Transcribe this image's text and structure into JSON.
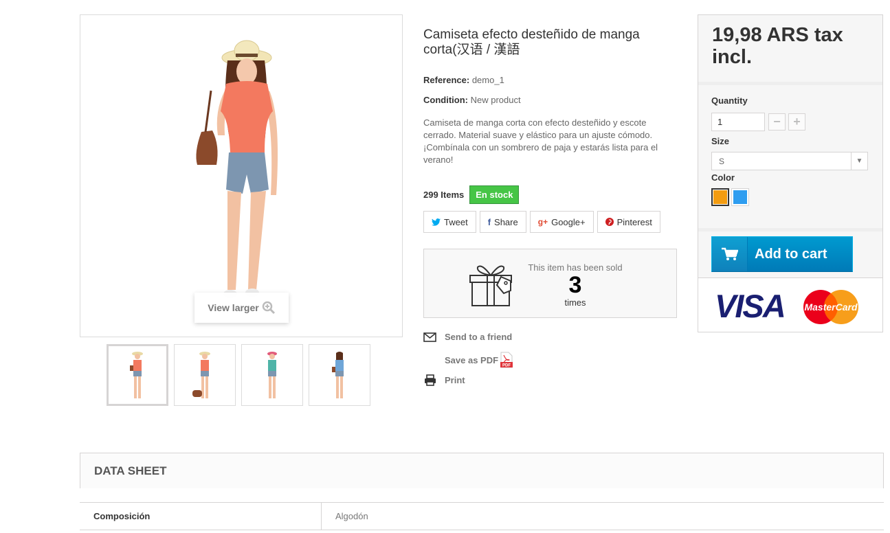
{
  "main_image": {
    "view_larger_label": "View larger",
    "thumbnail_count": 4
  },
  "product": {
    "title": "Camiseta efecto desteñido de manga corta(汉语 / 漢語",
    "reference_label": "Reference:",
    "reference_value": "demo_1",
    "condition_label": "Condition:",
    "condition_value": "New product",
    "description": "Camiseta de manga corta con efecto desteñido y escote cerrado. Material suave y elástico para un ajuste cómodo. ¡Combínala con un sombrero de paja y estarás lista para el verano!",
    "items_count": "299 Items",
    "stock_status": "En stock"
  },
  "social": [
    {
      "label": "Tweet",
      "icon": "twitter-icon",
      "color": "#00aaf0"
    },
    {
      "label": "Share",
      "icon": "facebook-icon",
      "color": "#435f9f"
    },
    {
      "label": "Google+",
      "icon": "google-plus-icon",
      "color": "#e04b34"
    },
    {
      "label": "Pinterest",
      "icon": "pinterest-icon",
      "color": "#ce1f21"
    }
  ],
  "sold": {
    "line1": "This item has been sold",
    "count": "3",
    "line2": "times"
  },
  "actions": {
    "send_friend": "Send to a friend",
    "save_pdf": "Save as PDF",
    "pdf_badge": "PDF",
    "print": "Print"
  },
  "buy": {
    "price": "19,98 ARS tax incl.",
    "quantity_label": "Quantity",
    "quantity_value": "1",
    "minus": "−",
    "plus": "+",
    "size_label": "Size",
    "size_value": "S",
    "color_label": "Color",
    "colors": [
      "#f39c11",
      "#2e9df0"
    ],
    "add_to_cart": "Add to cart",
    "payment_visa": "VISA",
    "payment_mastercard": "MasterCard"
  },
  "datasheet": {
    "title": "DATA SHEET",
    "rows": [
      {
        "name": "Composición",
        "value": "Algodón"
      }
    ]
  }
}
